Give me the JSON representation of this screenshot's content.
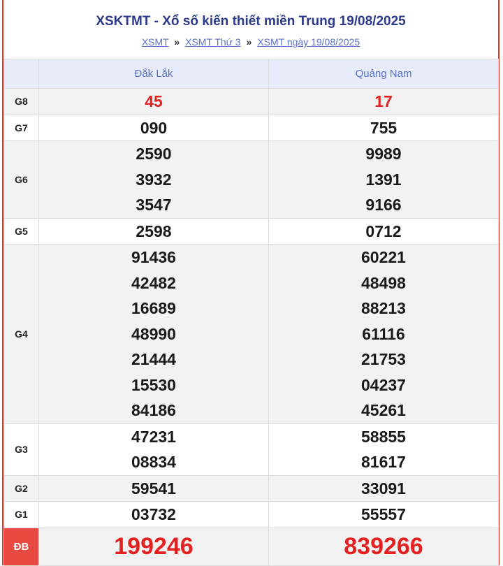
{
  "header": {
    "title": "XSKTMT - Xổ số kiến thiết miền Trung 19/08/2025",
    "breadcrumbs": [
      "XSMT",
      "XSMT Thứ 3",
      "XSMT ngày 19/08/2025"
    ],
    "separator": "»"
  },
  "provinces": [
    "Đắk Lắk",
    "Quảng Nam"
  ],
  "prizes": [
    {
      "label": "G8",
      "values": [
        [
          "45"
        ],
        [
          "17"
        ]
      ]
    },
    {
      "label": "G7",
      "values": [
        [
          "090"
        ],
        [
          "755"
        ]
      ]
    },
    {
      "label": "G6",
      "values": [
        [
          "2590",
          "3932",
          "3547"
        ],
        [
          "9989",
          "1391",
          "9166"
        ]
      ]
    },
    {
      "label": "G5",
      "values": [
        [
          "2598"
        ],
        [
          "0712"
        ]
      ]
    },
    {
      "label": "G4",
      "values": [
        [
          "91436",
          "42482",
          "16689",
          "48990",
          "21444",
          "15530",
          "84186"
        ],
        [
          "60221",
          "48498",
          "88213",
          "61116",
          "21753",
          "04237",
          "45261"
        ]
      ]
    },
    {
      "label": "G3",
      "values": [
        [
          "47231",
          "08834"
        ],
        [
          "58855",
          "81617"
        ]
      ]
    },
    {
      "label": "G2",
      "values": [
        [
          "59541"
        ],
        [
          "33091"
        ]
      ]
    },
    {
      "label": "G1",
      "values": [
        [
          "03732"
        ],
        [
          "55557"
        ]
      ]
    },
    {
      "label": "ĐB",
      "values": [
        [
          "199246"
        ],
        [
          "839266"
        ]
      ]
    }
  ],
  "colors": {
    "accent": "#e8302b",
    "title": "#2d3a8c",
    "link": "#5a70c8",
    "special": "#e32121"
  }
}
